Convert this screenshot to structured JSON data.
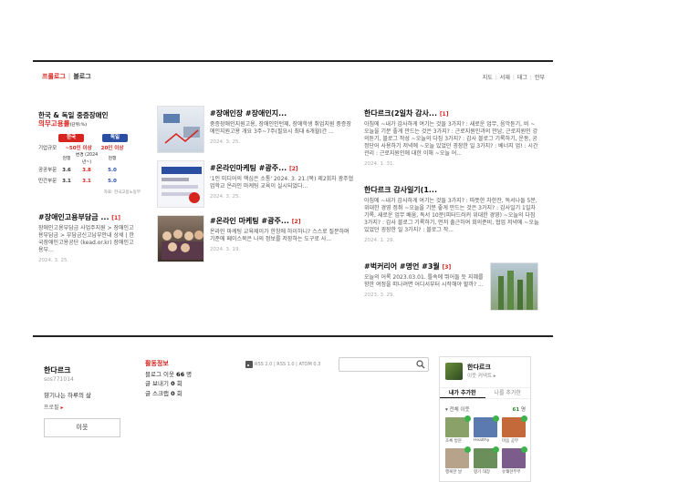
{
  "nav": {
    "tabs": [
      "프롤로그",
      "블로그"
    ],
    "util": [
      "지도",
      "서재",
      "태그",
      "안부"
    ]
  },
  "posts": [
    {
      "title": "#장애인고용부담금 ...",
      "count": "[1]",
      "desc": "장애인고용부담금 사업주지원 > 장애인고용부담금 > 부담금신고납부안내 상세 | 한국장애인고용공단 (kead.or.kr) 장애인고용부...",
      "date": "2024. 3. 25."
    },
    {
      "title": "#장애인장 #장애인지...",
      "count": "",
      "desc": "중증장애인지원고용, 장애인인턴제, 장애학생 취업지원 중증장애인지원고용 개요 3주~7주(필요시 최대 6개월)간 ...",
      "date": "2024. 3. 25."
    },
    {
      "title": "#온라인마케팅 #광주...",
      "count": "[2]",
      "desc": "'1인 미디어의 핵심은 소통' 2024. 3. 21.(목) 제2회차 광주협업학교 온라인 마케팅 교육이 실시되었다...",
      "date": "2024. 3. 25."
    },
    {
      "title": "#온라인 마케팅 #광주...",
      "count": "[2]",
      "desc": "온라인 마케팅 교육제이가 한창에 하이하니? 스스로 질문하며 기준에 페이스북은 나의 정보를 저장하는 도구로 사...",
      "date": "2024. 3. 19."
    },
    {
      "title": "한다르크(2일차 감사...",
      "count": "[1]",
      "desc": "아침에 ~내가 감사하게 여기는 것들 3가지? : 새로운 업무, 음악듣기, 비 ~오늘을 기분 좋게 만드는 것은 3가지? : 근로지원인과의 만남, 근로지원인 강의듣기, 블로그 작성 ~오늘의 다짐 3가지? : 감사 블로그 기록하기, 운동, 공정단어 사용하기 저녁에 ~오늘 있었던 굉장한 일 3가지? : 베너지 업! : 시간관리 : 근로지원인에 대한 이해 ~오늘 어...",
      "date": "2024. 1. 31."
    },
    {
      "title": "한다르크 감사일기(1...",
      "count": "",
      "desc": "아침에 ~내가 감사하게 여기는 것들 3가지? : 따뜻한 차한잔, 독서나들 5분, 위대한 경영 정취 ~오늘을 기분 좋게 만드는 것은 3가지? : 감사일기 1일차 기록, 새로운 업무 배움, 독서 10분(피터드러커 위대한 경영) ~오늘의 다짐 3가지? : 감사 블로그 기록하기, 먼저 출근하여 회의준비, 협업 저녁에 ~오늘 있었던 굉장한 일 3가지? : 블로그 작...",
      "date": "2024. 1. 29."
    },
    {
      "title": "#벅커리어 #명언 #3월",
      "count": "[3]",
      "desc": "오늘의 어록 2023.03.01. 틀속에 뛰어들 듯 지혜를 향한 여정을 떠나려면 어디서부터 시작해야 할까? ...",
      "date": "2023. 3. 29."
    }
  ],
  "infographic": {
    "heading_line1": "한국 & 독일 중증장애인",
    "heading_line2": "의무고용률",
    "heading_unit": "(단위:%)",
    "col_kr": "한국",
    "col_de": "독일",
    "row1_label": "기업규모",
    "kr_size": "~50인 이상",
    "de_size": "20인 이상",
    "row2_label": "",
    "kr_now": "현행",
    "kr_change": "변경 (2024년~)",
    "de_now": "현행",
    "gov_label": "공공부문",
    "gov_now": "3.6",
    "gov_new": "3.8",
    "gov_de": "5.0",
    "priv_label": "민간부문",
    "priv_now": "3.1",
    "priv_new": "3.1",
    "priv_de": "5.0",
    "source": "자료: 한국고용노동부"
  },
  "profile": {
    "blog_name": "한다르크",
    "blog_id": "sos771014",
    "description": "향기나는 하루의 삶",
    "profile_link": "프로필",
    "follow_label": "이웃"
  },
  "activity": {
    "title": "활동정보",
    "neighbors_label": "블로그 이웃",
    "neighbors_count": "66",
    "neighbors_unit": "명",
    "shares_label": "글 보내기",
    "shares_count": "0",
    "shares_unit": "회",
    "scraps_label": "글 스크랩",
    "scraps_count": "0",
    "scraps_unit": "회"
  },
  "rss": "RSS 2.0 | RSS 1.0 | ATOM 0.3",
  "search": {
    "placeholder": ""
  },
  "sidebar": {
    "name": "한다르크",
    "follow_text": "이웃 커넥트 ▸",
    "tab_mine": "내가 추가한",
    "tab_others": "나를 추가한",
    "filter": "▾ 전체 이웃",
    "count": "61",
    "count_unit": "명",
    "neighbors": [
      {
        "caption": "초록 방문",
        "color": "#8aa16a"
      },
      {
        "caption": "Healthy",
        "color": "#5b7bb0"
      },
      {
        "caption": "마음 공부",
        "color": "#c46a3a"
      },
      {
        "caption": "행복한 날",
        "color": "#b7a28c"
      },
      {
        "caption": "향기 대장",
        "color": "#6a8f5a"
      },
      {
        "caption": "유쾌한부부",
        "color": "#7b5c8a"
      }
    ]
  }
}
